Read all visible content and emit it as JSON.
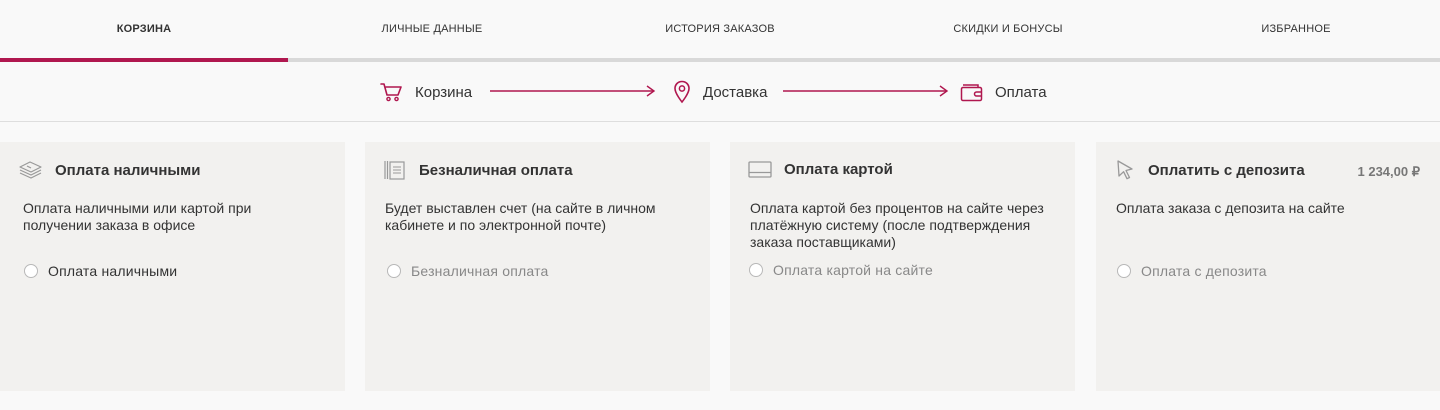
{
  "tabs": [
    {
      "label": "КОРЗИНА",
      "active": true
    },
    {
      "label": "ЛИЧНЫЕ ДАННЫЕ",
      "active": false
    },
    {
      "label": "ИСТОРИЯ ЗАКАЗОВ",
      "active": false
    },
    {
      "label": "СКИДКИ И БОНУСЫ",
      "active": false
    },
    {
      "label": "ИЗБРАННОЕ",
      "active": false
    }
  ],
  "steps": [
    {
      "label": "Корзина",
      "icon": "cart-icon"
    },
    {
      "label": "Доставка",
      "icon": "location-pin-icon"
    },
    {
      "label": "Оплата",
      "icon": "wallet-icon"
    }
  ],
  "payment_methods": [
    {
      "title": "Оплата наличными",
      "icon": "cash-stack-icon",
      "description": "Оплата наличными или картой при получении заказа в офисе",
      "option_label": "Оплата наличными",
      "option_enabled": true
    },
    {
      "title": "Безналичная оплата",
      "icon": "invoice-icon",
      "description": "Будет выставлен счет (на сайте в личном кабинете и по электронной почте)",
      "option_label": "Безналичная оплата",
      "option_enabled": false
    },
    {
      "title": "Оплата картой",
      "icon": "card-icon",
      "description": "Оплата картой без процентов на сайте через платёжную систему (после подтверждения заказа поставщиками)",
      "option_label": "Оплата картой на сайте",
      "option_enabled": false
    },
    {
      "title": "Оплатить с депозита",
      "icon": "cursor-icon",
      "amount": "1 234,00 ₽",
      "description": "Оплата заказа с депозита на сайте",
      "option_label": "Оплата с депозита",
      "option_enabled": false
    }
  ],
  "colors": {
    "accent": "#b0174f",
    "tab_underline": "#d9d9d9",
    "card_bg": "#f2f1ef",
    "page_bg": "#f9f9f9"
  }
}
